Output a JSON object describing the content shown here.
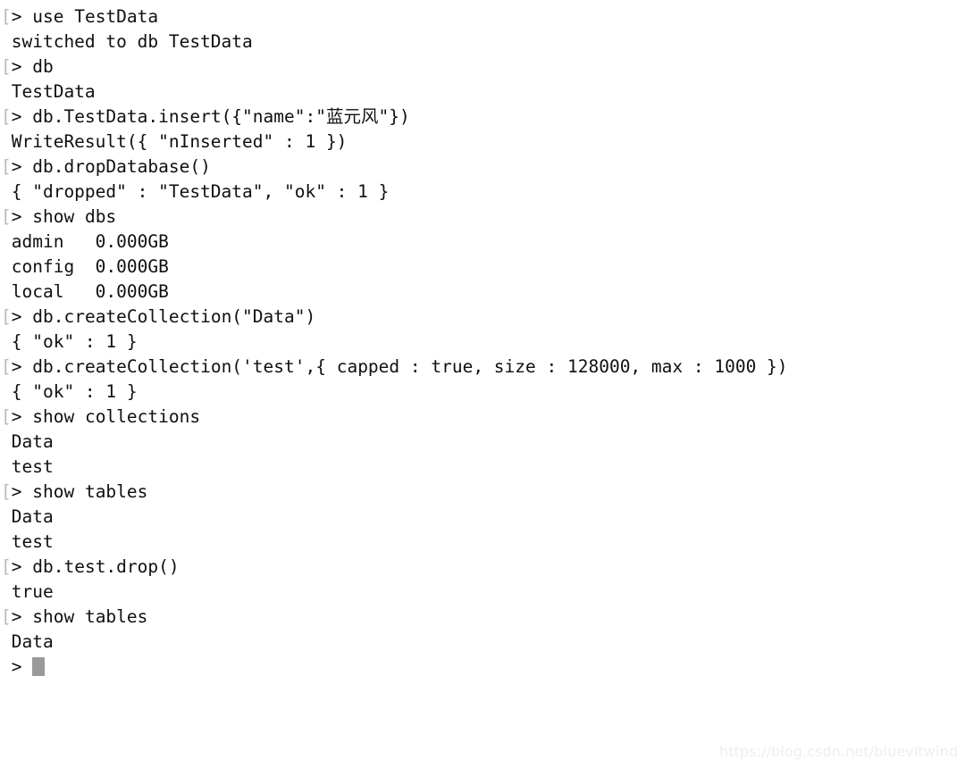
{
  "terminal": {
    "shell_name": "mongo-shell",
    "background_color": "#ffffff",
    "text_color": "#101010",
    "prompt_bracket_color": "#b9b9b9",
    "cursor_color": "#9a9a9a",
    "prompt_symbol": ">",
    "prompt_bracket": "[",
    "lines": [
      {
        "kind": "command",
        "text": "use TestData"
      },
      {
        "kind": "output",
        "text": " switched to db TestData"
      },
      {
        "kind": "command",
        "text": "db"
      },
      {
        "kind": "output",
        "text": " TestData"
      },
      {
        "kind": "command",
        "text": "db.TestData.insert({\"name\":\"蓝元风\"})"
      },
      {
        "kind": "output",
        "text": " WriteResult({ \"nInserted\" : 1 })"
      },
      {
        "kind": "command",
        "text": "db.dropDatabase()"
      },
      {
        "kind": "output",
        "text": " { \"dropped\" : \"TestData\", \"ok\" : 1 }"
      },
      {
        "kind": "command",
        "text": "show dbs"
      },
      {
        "kind": "output",
        "text": " admin   0.000GB"
      },
      {
        "kind": "output",
        "text": " config  0.000GB"
      },
      {
        "kind": "output",
        "text": " local   0.000GB"
      },
      {
        "kind": "command",
        "text": "db.createCollection(\"Data\")"
      },
      {
        "kind": "output",
        "text": " { \"ok\" : 1 }"
      },
      {
        "kind": "command",
        "text": "db.createCollection('test',{ capped : true, size : 128000, max : 1000 })"
      },
      {
        "kind": "output",
        "text": " { \"ok\" : 1 }"
      },
      {
        "kind": "command",
        "text": "show collections"
      },
      {
        "kind": "output",
        "text": " Data"
      },
      {
        "kind": "output",
        "text": " test"
      },
      {
        "kind": "command",
        "text": "show tables"
      },
      {
        "kind": "output",
        "text": " Data"
      },
      {
        "kind": "output",
        "text": " test"
      },
      {
        "kind": "command",
        "text": "db.test.drop()"
      },
      {
        "kind": "output",
        "text": " true"
      },
      {
        "kind": "command",
        "text": "show tables"
      },
      {
        "kind": "output",
        "text": " Data"
      },
      {
        "kind": "cursor",
        "text": " >"
      }
    ]
  },
  "watermark": {
    "text": "https://blog.csdn.net/bluevitwind",
    "color": "#eceef0"
  }
}
